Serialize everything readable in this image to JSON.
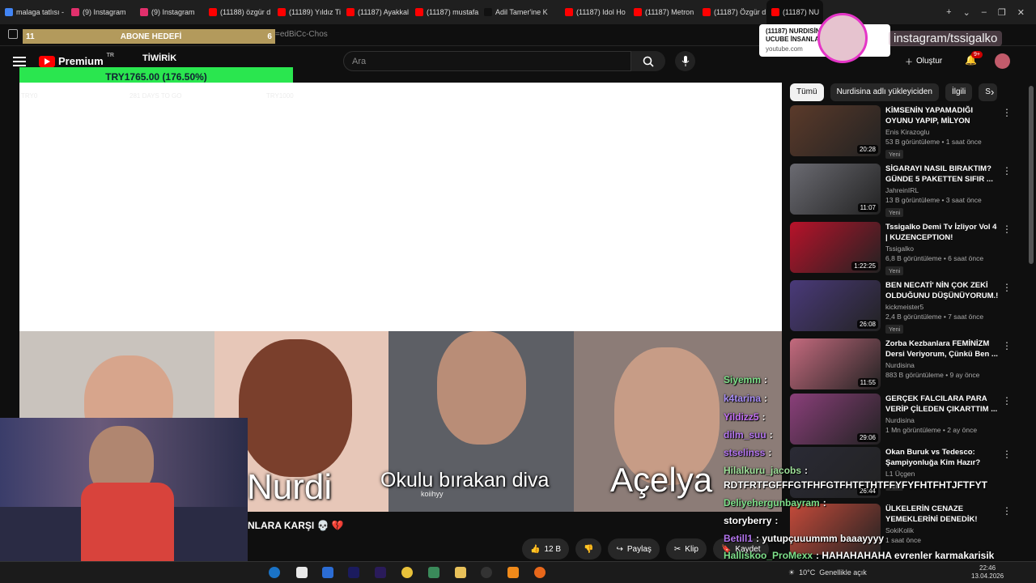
{
  "browser": {
    "tabs": [
      {
        "label": "malaga tatlısı - G",
        "color": "#4285f4"
      },
      {
        "label": "(9) Instagram",
        "color": "#e1306c"
      },
      {
        "label": "(9) Instagram",
        "color": "#e1306c"
      },
      {
        "label": "(11188) özgür d",
        "color": "#ff0000"
      },
      {
        "label": "(11189) Yıldız Ti",
        "color": "#ff0000"
      },
      {
        "label": "(11187) Ayakkal",
        "color": "#ff0000"
      },
      {
        "label": "(11187) mustafa",
        "color": "#ff0000"
      },
      {
        "label": "Adil Tamer'ine K",
        "color": "#111111"
      },
      {
        "label": "(11187) Idol Ho",
        "color": "#ff0000"
      },
      {
        "label": "(11187) Metron",
        "color": "#ff0000"
      },
      {
        "label": "(11187) Özgür d",
        "color": "#ff0000"
      },
      {
        "label": "(11187) NU",
        "color": "#ff0000"
      }
    ],
    "url_fragment": "=edBiCc-Chos",
    "tooltip_title": "(11187) NURDISİNA ... ÜNFAHA UCUBE İNSANLA...",
    "tooltip_site": "youtube.com"
  },
  "overlay": {
    "abone_left": "11",
    "abone_label": "ABONE HEDEFİ",
    "abone_right": "6",
    "donation": "TRY1765.00 (176.50%)",
    "ghost_left": "TRY0",
    "ghost_mid": "281 DAYS TO GO",
    "ghost_right": "TRY1000",
    "instagram_handle": "instagram/tssigalko"
  },
  "youtube": {
    "logo": "Premium",
    "logo_region": "TR",
    "channel_tag": "TİWİRİK",
    "search_placeholder": "Ara",
    "create_label": "Oluştur",
    "notif_badge": "9+"
  },
  "video": {
    "captions": [
      "Nurdi",
      "Okulu bırakan diva",
      "Açelya"
    ],
    "watermark": "koiihyy",
    "title_partial": "NLARA KARŞI 💀 💔"
  },
  "actions": {
    "likes": "12 B",
    "share": "Paylaş",
    "clip": "Klip",
    "save": "Kaydet"
  },
  "chat": [
    {
      "user": "Siyemm",
      "text": ":",
      "color": "#7ee08a"
    },
    {
      "user": "k4tarina",
      "text": ":",
      "color": "#a98ff7"
    },
    {
      "user": "Yildizz5",
      "text": ":",
      "color": "#c470f5"
    },
    {
      "user": "dilm_suu",
      "text": ":",
      "color": "#b576f0"
    },
    {
      "user": "stselinss",
      "text": ":",
      "color": "#b576f0"
    },
    {
      "user": "Hilalkuru_jacobs",
      "text": ":",
      "color": "#9fe09a"
    },
    {
      "user": "",
      "text": "RDTFRTFGFFFGTFHFGTFHTFTHTFFYFYFHTFHTJFTFYT",
      "color": "#ffffff"
    },
    {
      "user": "Deliyehergunbayram",
      "text": ":",
      "color": "#7ee08a"
    },
    {
      "user": "storyberry",
      "text": ":",
      "color": "#ffffff"
    },
    {
      "user": "Betill1",
      "text": ": yutupçuuummm baaayyyy",
      "color": "#b576f0"
    },
    {
      "user": "Halliskoo_ProMexx",
      "text": ": HAHAHAHAHA evrenler karmakarisik",
      "color": "#7ee08a"
    }
  ],
  "chips": [
    "Tümü",
    "Nurdisina adlı yükleyiciden",
    "İlgili",
    "S"
  ],
  "recommendations": [
    {
      "title": "KİMSENİN YAPAMADIĞI OYUNU YAPIP, MİLYON DOLARLAR ...",
      "channel": "Enis Kirazoglu",
      "views": "53 B görüntüleme • 1 saat önce",
      "duration": "20:28",
      "badge": "Yeni",
      "thumb": "#5b3a2a"
    },
    {
      "title": "SİGARAYI NASIL BIRAKTIM? GÜNDE 5 PAKETTEN SIFIR ...",
      "channel": "JahreinIRL",
      "views": "13 B görüntüleme • 3 saat önce",
      "duration": "11:07",
      "badge": "Yeni",
      "thumb": "#6b6b72"
    },
    {
      "title": "Tssigalko Demi Tv İzliyor Vol 4 | KUZENCEPTION! @AADemiTV",
      "channel": "Tssigalko",
      "views": "6,8 B görüntüleme • 6 saat önce",
      "duration": "1:22:25",
      "badge": "Yeni",
      "thumb": "#b8122a"
    },
    {
      "title": "BEN NECATİ' NİN ÇOK ZEKİ OLDUĞUNU DÜŞÜNÜYORUM.! ...",
      "channel": "kickmeister5",
      "views": "2,4 B görüntüleme • 7 saat önce",
      "duration": "26:08",
      "badge": "Yeni",
      "thumb": "#4a3a7a"
    },
    {
      "title": "Zorba Kezbanlara FEMİNİZM Dersi Veriyorum, Çünkü Ben ...",
      "channel": "Nurdisina",
      "views": "883 B görüntüleme • 9 ay önce",
      "duration": "11:55",
      "badge": "",
      "thumb": "#c46a7e"
    },
    {
      "title": "GERÇEK FALCILARA PARA VERİP ÇİLEDEN ÇIKARTTIM ...",
      "channel": "Nurdisina",
      "views": "1 Mn görüntüleme • 2 ay önce",
      "duration": "29:06",
      "badge": "",
      "thumb": "#8a3f7a"
    },
    {
      "title": "Okan Buruk vs Tedesco: Şampiyonluğa Kim Hazır?",
      "channel": "L1 Üçgen",
      "views": "",
      "duration": "26:44",
      "badge": "Yeni",
      "thumb": "#2a2a35"
    },
    {
      "title": "ÜLKELERİN CENAZE YEMEKLERİNİ DENEDİK!",
      "channel": "SokiKolik",
      "views": "1 saat önce",
      "duration": "",
      "badge": "",
      "thumb": "#c44a3a"
    }
  ],
  "taskbar": {
    "temp": "10°C",
    "weather": "Genellikle açık",
    "time": "22:46",
    "date": "13.04.2026"
  }
}
